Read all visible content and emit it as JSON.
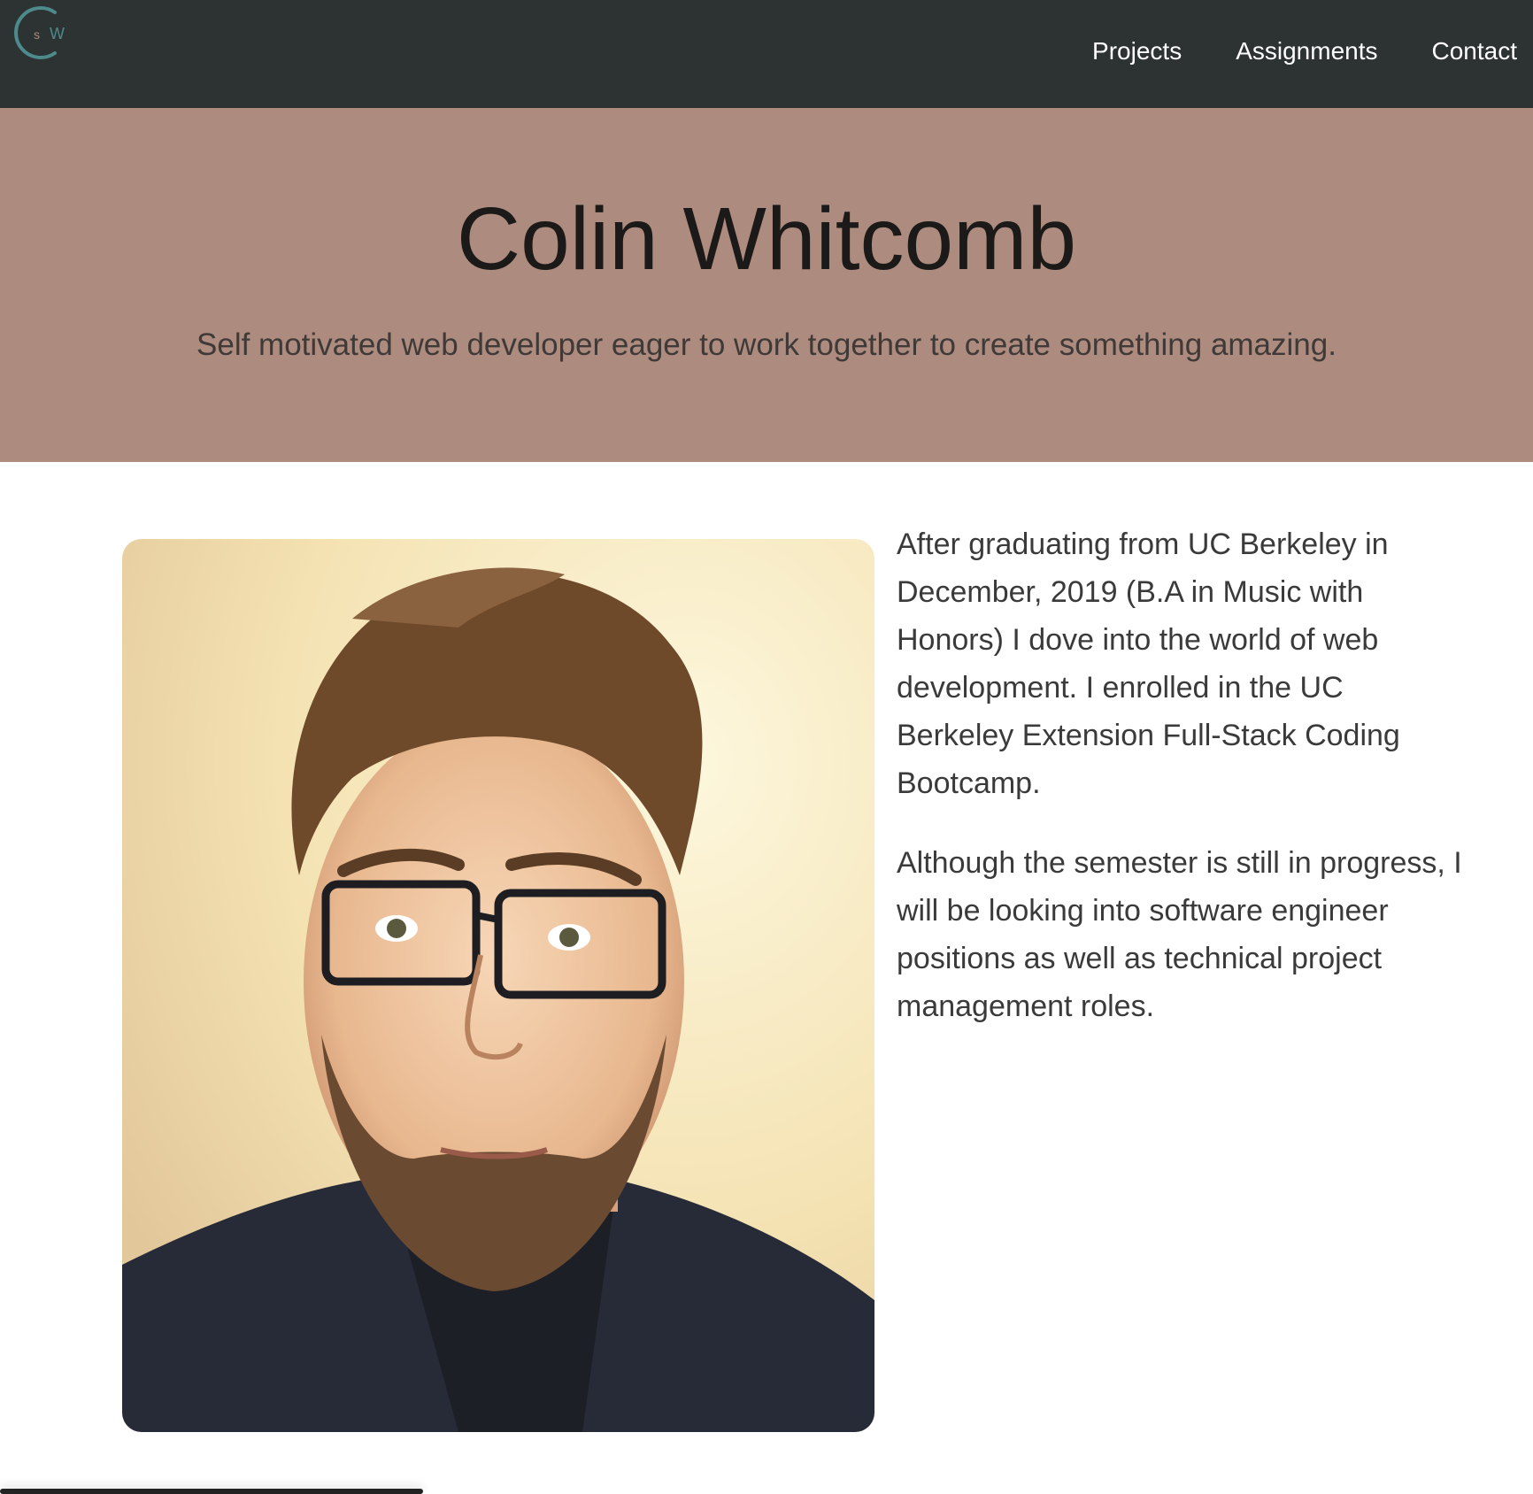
{
  "nav": {
    "logo_letters": "C S W",
    "links": [
      {
        "label": "Projects"
      },
      {
        "label": "Assignments"
      },
      {
        "label": "Contact"
      }
    ]
  },
  "hero": {
    "title": "Colin Whitcomb",
    "subtitle": "Self motivated web developer eager to work together to create something amazing."
  },
  "about": {
    "photo_alt": "Portrait photo",
    "paragraphs": [
      "After graduating from UC Berkeley in December, 2019 (B.A in Music with Honors) I dove into the world of web development. I enrolled in the UC Berkeley Extension Full-Stack Coding Bootcamp.",
      "Although the semester is still in progress, I will be looking into software engineer positions as well as technical project management roles."
    ]
  },
  "colors": {
    "navbar": "#2d3232",
    "hero": "#ad8b7e",
    "logo": "#4c8a8c"
  }
}
